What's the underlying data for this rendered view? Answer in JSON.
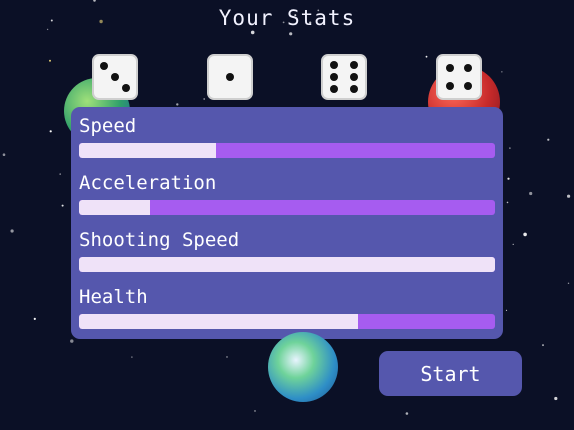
{
  "title": "Your Stats",
  "dice": [
    {
      "value": 3,
      "icon": "dice-three-icon"
    },
    {
      "value": 1,
      "icon": "dice-one-icon"
    },
    {
      "value": 6,
      "icon": "dice-six-icon"
    },
    {
      "value": 4,
      "icon": "dice-four-icon"
    }
  ],
  "stats": [
    {
      "label": "Speed",
      "fill_fraction": 0.33
    },
    {
      "label": "Acceleration",
      "fill_fraction": 0.17
    },
    {
      "label": "Shooting Speed",
      "fill_fraction": 1.0
    },
    {
      "label": "Health",
      "fill_fraction": 0.67
    }
  ],
  "start_label": "Start",
  "colors": {
    "background": "#0b1026",
    "panel": "#5557ad",
    "bar_track": "#a65cf0",
    "bar_fill": "#efe2f8",
    "text": "#ffffff"
  }
}
